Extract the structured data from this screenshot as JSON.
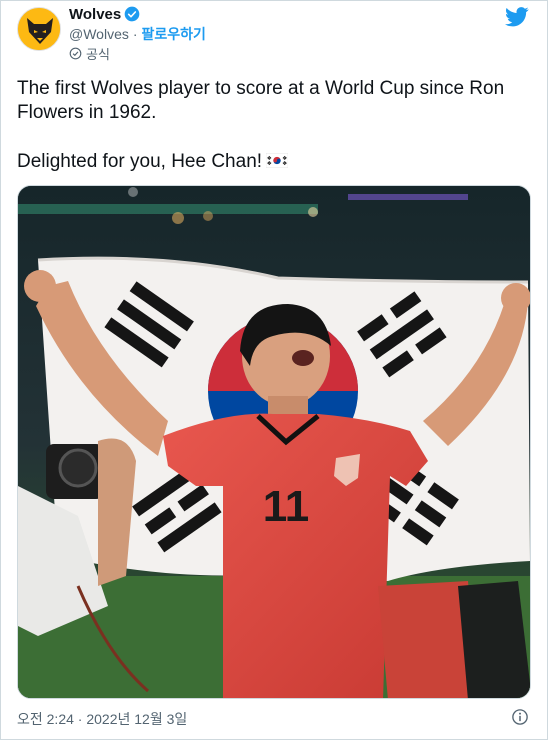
{
  "account": {
    "display_name": "Wolves",
    "handle": "@Wolves",
    "separator": "·",
    "follow_label": "팔로우하기",
    "official_label": "공식"
  },
  "tweet": {
    "line1": "The first Wolves player to score at a World Cup since Ron Flowers in 1962.",
    "line2": "Delighted for you, Hee Chan!"
  },
  "media": {
    "jersey_number": "11"
  },
  "footer": {
    "timestamp": "오전 2:24 · 2022년 12월 3일"
  },
  "icons": {
    "avatar": "wolves-crest-icon",
    "verified": "verified-badge-icon",
    "official": "official-label-icon",
    "bird": "twitter-bird-icon",
    "flag": "south-korea-flag-icon",
    "info": "info-icon"
  },
  "colors": {
    "accent": "#1d9bf0",
    "brand_gold": "#fdb913",
    "text": "#0f1419",
    "muted": "#536471"
  }
}
